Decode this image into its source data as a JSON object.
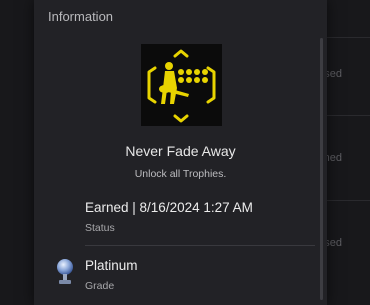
{
  "panel": {
    "title": "Information"
  },
  "background_list": {
    "item_suffixes": [
      "sed",
      "ned",
      "sed"
    ]
  },
  "trophy": {
    "name": "Never Fade Away",
    "description": "Unlock all Trophies.",
    "art_icon": "trophy-art-silhouette",
    "accent_color": "#e8d400"
  },
  "status": {
    "value": "Earned | 8/16/2024  1:27 AM",
    "label": "Status"
  },
  "grade": {
    "value": "Platinum",
    "label": "Grade",
    "icon": "platinum-trophy-icon"
  }
}
